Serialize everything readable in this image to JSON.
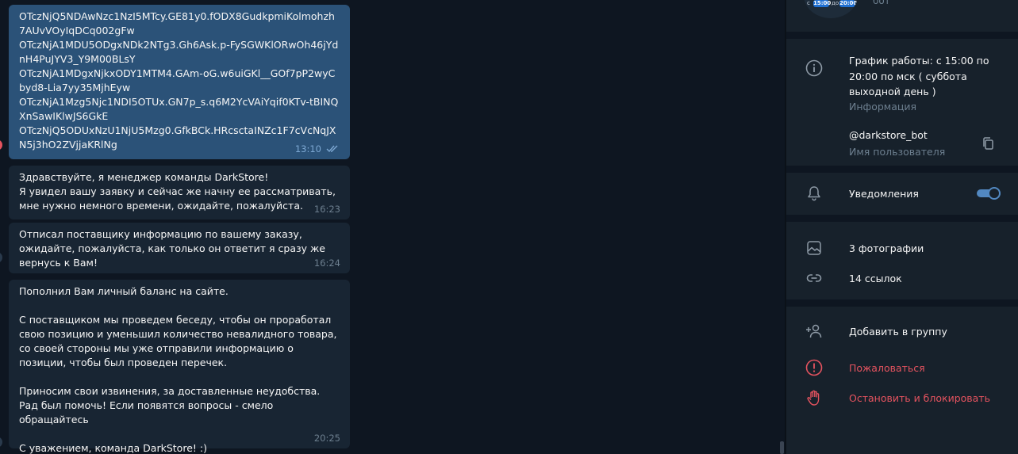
{
  "messages": [
    {
      "text": "OTczNjQ5NDAwNzc1NzI5MTcy.GE81y0.fODX8GudkpmiKolmohzh7AUvVOyIqDCq002gFw\nOTczNjA1MDU5ODgxNDk2NTg3.Gh6Ask.p-FySGWKlORwOh46jYdnH4PuJYV3_Y9M00BLsY\nOTczNjA1MDgxNjkxODY1MTM4.GAm-oG.w6uiGKl__GOf7pP2wyCbyd8-Lia7yy35MjhEyw\nOTczNjA1Mzg5Njc1NDI5OTUx.GN7p_s.q6M2YcVAiYqif0KTv-tBINQXnSawIKlwJS6GkE\nOTczNjQ5ODUxNzU1NjU5Mzg0.GfkBCk.HRcsctaINZc1F7cVcNqJXN5j3hO2ZVjjaKRlNg",
      "time": "13:10",
      "direction": "outgoing",
      "read": true
    },
    {
      "text": "Здравствуйте, я менеджер команды DarkStore!\nЯ увидел вашу заявку и сейчас же начну ее рассматривать, мне нужно немного времени, ожидайте, пожалуйста.",
      "time": "16:23",
      "direction": "incoming"
    },
    {
      "text": "Отписал поставщику информацию по вашему заказу, ожидайте, пожалуйста, как только он ответит я сразу же вернусь к Вам!",
      "time": "16:24",
      "direction": "incoming"
    },
    {
      "text": "Пополнил Вам личный баланс на сайте.\n\nС поставщиком мы проведем беседу, чтобы он проработал свою позицию и уменьшил количество невалидного товара, со своей стороны мы уже отправили информацию о позиции, чтобы был проведен перечек.\n\nПриносим свои извинения, за доставленные неудобства.\nРад был помочь! Если появятся вопросы - смело обращайтесь\n\nС уважением,  команда DarkStore! :)",
      "time": "20:25",
      "direction": "incoming"
    }
  ],
  "profile": {
    "avatar_badge_start": "15:00",
    "avatar_badge_end": "20:00",
    "avatar_left_text": "с",
    "avatar_mid_text": "до",
    "status_fragment": "бот",
    "info": {
      "text": "График работы: с 15:00 по 20:00 по мск ( суббота выходной день )",
      "label": "Информация"
    },
    "username": {
      "value": "@darkstore_bot",
      "label": "Имя пользователя"
    },
    "notifications": {
      "label": "Уведомления",
      "enabled": true
    },
    "media": {
      "photos": "3 фотографии",
      "links": "14 ссылок"
    },
    "actions": {
      "add_to_group": "Добавить в группу",
      "report": "Пожаловаться",
      "block": "Остановить и блокировать"
    }
  },
  "colors": {
    "chat_bg": "#0e1621",
    "panel_bg": "#17212b",
    "outgoing_bubble": "#2b5278",
    "incoming_bubble": "#182533",
    "accent": "#5288c1",
    "danger": "#e5535f"
  },
  "icons": {
    "info": "info-circle-icon",
    "copy": "copy-icon",
    "notifications": "bell-icon",
    "photos": "photo-icon",
    "links": "link-icon",
    "add_to_group": "add-user-icon",
    "report": "warning-circle-icon",
    "block": "hand-stop-icon",
    "read": "double-check-icon"
  }
}
